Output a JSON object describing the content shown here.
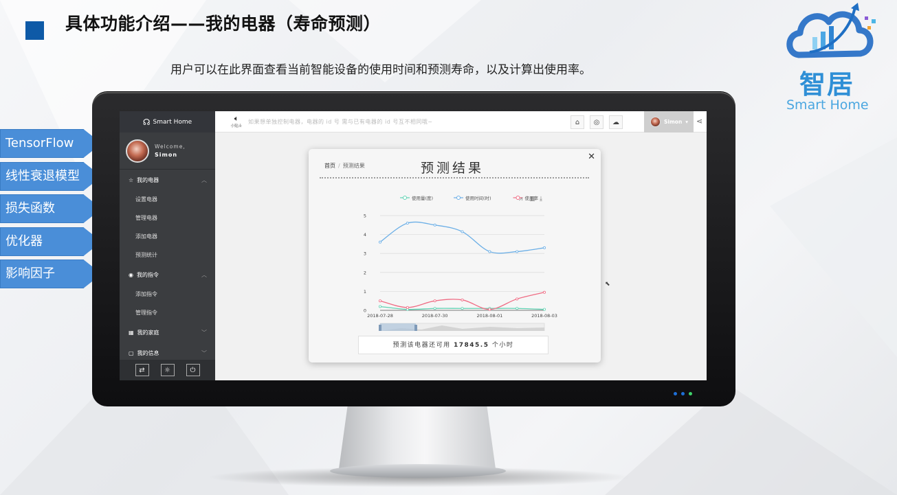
{
  "slide": {
    "title": "具体功能介绍——我的电器（寿命预测）",
    "subtitle": "用户可以在此界面查看当前智能设备的使用时间和预测寿命，以及计算出使用率。"
  },
  "logo": {
    "cn": "智居",
    "en": "Smart Home"
  },
  "tags": [
    "TensorFlow",
    "线性衰退模型",
    "损失函数",
    "优化器",
    "影响因子"
  ],
  "app": {
    "brand": "Smart Home",
    "welcome": "Welcome,",
    "user": "Simon",
    "menu": {
      "g1": "我的电器",
      "g1_items": [
        "设置电器",
        "管理电器",
        "添加电器",
        "预测统计"
      ],
      "g2": "我的指令",
      "g2_items": [
        "添加指令",
        "管理指令"
      ],
      "g3": "我的家庭",
      "g4": "我的信息"
    },
    "topbar": {
      "speaker_label": "小贴士",
      "tip": "如果想单独控制电器，电器的 id 号 需与已有电器的 id 号互不相同哦~",
      "user": "Simon"
    },
    "modal": {
      "crumb_home": "首页",
      "crumb_current": "预测结果",
      "title": "预测结果",
      "result_prefix": "预测该电器还可用",
      "result_value": "17845.5",
      "result_suffix": "个小时"
    }
  },
  "chart_data": {
    "type": "line",
    "x": [
      "2018-07-28",
      "2018-07-29",
      "2018-07-30",
      "2018-07-31",
      "2018-08-01",
      "2018-08-02",
      "2018-08-03"
    ],
    "xticks": [
      "2018-07-28",
      "2018-07-30",
      "2018-08-01",
      "2018-08-03"
    ],
    "ylim": [
      0,
      5
    ],
    "yticks": [
      0,
      1,
      2,
      3,
      4,
      5
    ],
    "legend_position": "top",
    "series": [
      {
        "name": "使用量(度)",
        "color": "#5fd3b3",
        "values": [
          0.2,
          0.05,
          0.1,
          0.1,
          0.1,
          0.1,
          0.05
        ]
      },
      {
        "name": "使用时间(时)",
        "color": "#6aaee6",
        "values": [
          3.6,
          4.6,
          4.5,
          4.15,
          3.1,
          3.1,
          3.3
        ]
      },
      {
        "name": "使用率",
        "color": "#ef6b83",
        "values": [
          0.5,
          0.15,
          0.5,
          0.55,
          0.05,
          0.6,
          0.95
        ]
      }
    ]
  }
}
